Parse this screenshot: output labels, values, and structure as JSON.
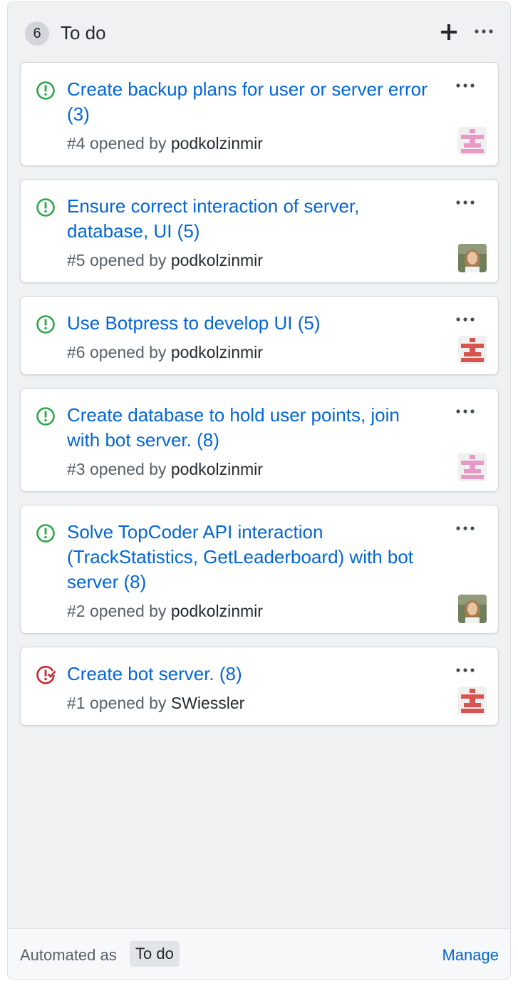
{
  "column": {
    "count": "6",
    "title": "To do",
    "footer": {
      "automated_label": "Automated as",
      "automated_value": "To do",
      "manage_label": "Manage"
    }
  },
  "cards": [
    {
      "title": "Create backup plans for user or server error (3)",
      "number": "#4",
      "opened_by": "opened by",
      "author": "podkolzinmir",
      "state": "open",
      "avatar": "pink-identicon"
    },
    {
      "title": "Ensure correct interaction of server, database, UI (5)",
      "number": "#5",
      "opened_by": "opened by",
      "author": "podkolzinmir",
      "state": "open",
      "avatar": "photo-avatar"
    },
    {
      "title": "Use Botpress to develop UI (5)",
      "number": "#6",
      "opened_by": "opened by",
      "author": "podkolzinmir",
      "state": "open",
      "avatar": "red-identicon"
    },
    {
      "title": "Create database to hold user points, join with bot server. (8)",
      "number": "#3",
      "opened_by": "opened by",
      "author": "podkolzinmir",
      "state": "open",
      "avatar": "pink-identicon"
    },
    {
      "title": "Solve TopCoder API interaction (TrackStatistics, GetLeaderboard) with bot server (8)",
      "number": "#2",
      "opened_by": "opened by",
      "author": "podkolzinmir",
      "state": "open",
      "avatar": "photo-avatar"
    },
    {
      "title": "Create bot server. (8)",
      "number": "#1",
      "opened_by": "opened by",
      "author": "SWiessler",
      "state": "closed",
      "avatar": "red-identicon"
    }
  ],
  "colors": {
    "open_state": "#28a745",
    "closed_state": "#cb2431",
    "link": "#0366d6",
    "pink_identicon": "#e89ac7",
    "red_identicon": "#d9534f"
  }
}
